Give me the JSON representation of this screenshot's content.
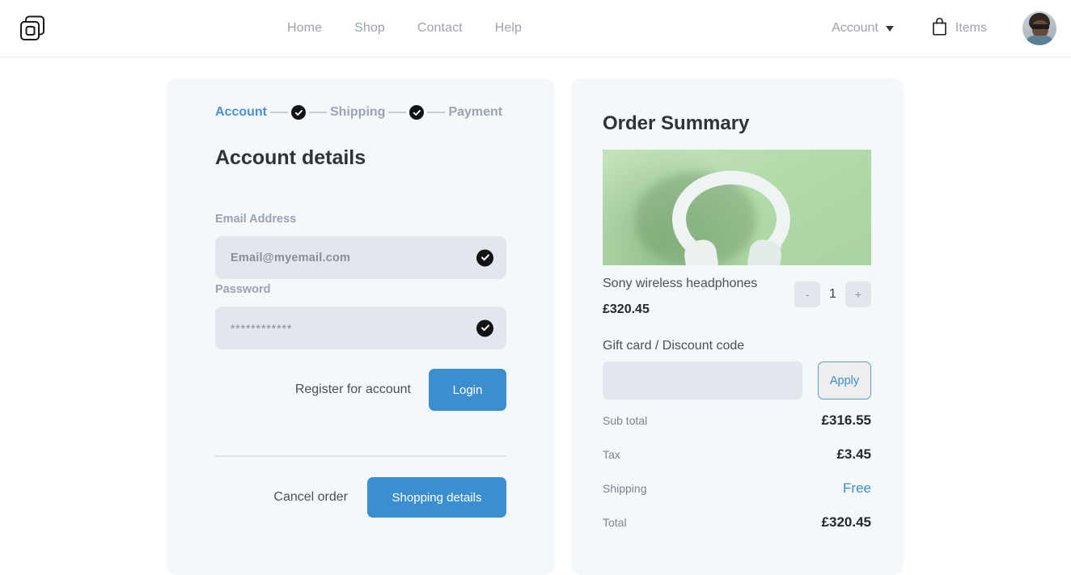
{
  "header": {
    "logo_icon": "overlapping-squares-logo",
    "nav": [
      {
        "label": "Home"
      },
      {
        "label": "Shop"
      },
      {
        "label": "Contact"
      },
      {
        "label": "Help"
      }
    ],
    "account": {
      "label": "Account",
      "caret_icon": "chevron-down-icon"
    },
    "items": {
      "label": "Items",
      "icon": "shopping-bag-icon"
    },
    "avatar_icon": "user-avatar-photo"
  },
  "checkout": {
    "steps": [
      {
        "label": "Account",
        "state": "active"
      },
      {
        "label": "Shipping",
        "state": "idle"
      },
      {
        "label": "Payment",
        "state": "idle"
      }
    ],
    "step_check_icon": "check-circle-icon",
    "title": "Account details",
    "email": {
      "label": "Email Address",
      "value": "Email@myemail.com",
      "valid_icon": "check-circle-icon"
    },
    "password": {
      "label": "Password",
      "value": "************",
      "valid_icon": "check-circle-icon"
    },
    "register_label": "Register for account",
    "login_label": "Login",
    "cancel_label": "Cancel order",
    "shopping_details_label": "Shopping details"
  },
  "summary": {
    "title": "Order Summary",
    "product": {
      "image_alt": "white-wireless-headphones-on-green-background",
      "name": "Sony wireless headphones",
      "price": "£320.45",
      "qty": "1",
      "decrement_label": "-",
      "increment_label": "+"
    },
    "discount": {
      "label": "Gift card / Discount code",
      "value": "",
      "placeholder": "",
      "apply_label": "Apply"
    },
    "totals": [
      {
        "label": "Sub total",
        "value": "£316.55"
      },
      {
        "label": "Tax",
        "value": "£3.45"
      },
      {
        "label": "Shipping",
        "value": "Free"
      },
      {
        "label": "Total",
        "value": "£320.45"
      }
    ]
  },
  "colors": {
    "accent_blue": "#3b8ed0",
    "step_active": "#4a90d9",
    "muted_text": "#9aa4b0",
    "card_bg": "#f5f8fb",
    "input_bg": "#e2e7ee",
    "product_bg": "#b3dcae"
  }
}
